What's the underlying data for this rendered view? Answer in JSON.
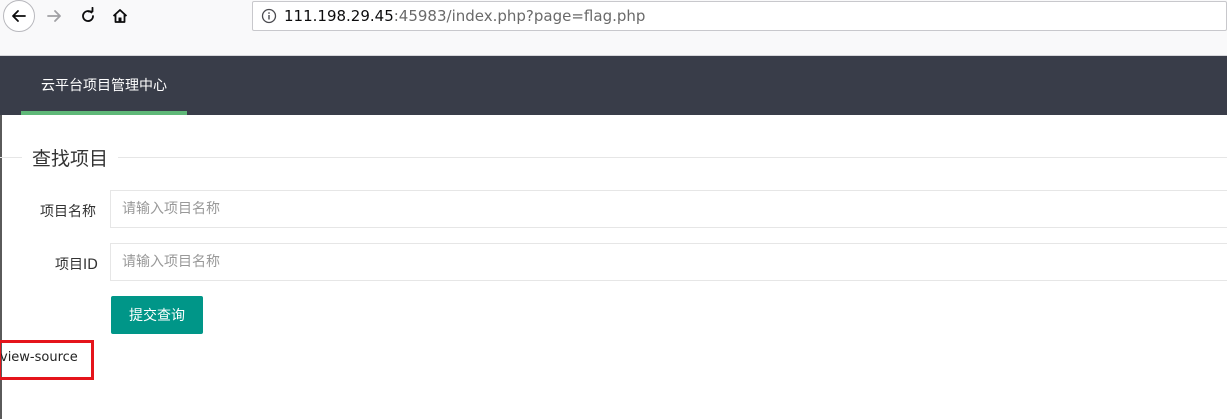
{
  "browser": {
    "url_host": "111.198.29.45",
    "url_rest": ":45983/index.php?page=flag.php"
  },
  "header": {
    "brand": "云平台项目管理中心"
  },
  "form": {
    "legend": "查找项目",
    "name_label": "项目名称",
    "name_placeholder": "请输入项目名称",
    "id_label": "项目ID",
    "id_placeholder": "请输入项目名称",
    "submit_label": "提交查询"
  },
  "annotation": {
    "text": "view-source",
    "box_color": "#e5141b"
  },
  "colors": {
    "header_bg": "#393d49",
    "brand_underline": "#5fb878",
    "button_bg": "#009688"
  }
}
